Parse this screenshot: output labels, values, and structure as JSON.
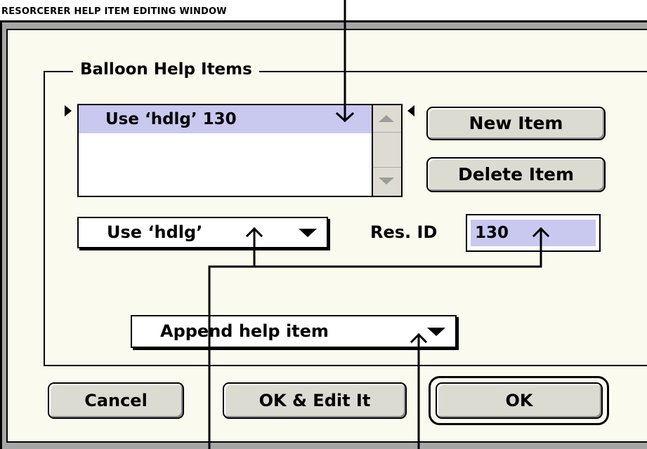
{
  "caption": "RESORCERER HELP ITEM EDITING WINDOW",
  "group_box": {
    "title": "Balloon Help Items"
  },
  "items_list": {
    "items": [
      "Use ‘hdlg’ 130"
    ],
    "selected_index": 0
  },
  "buttons": {
    "new_item": "New Item",
    "delete_item": "Delete Item",
    "cancel": "Cancel",
    "ok_edit": "OK & Edit It",
    "ok": "OK"
  },
  "type_popup": {
    "value": "Use ‘hdlg’"
  },
  "res_id": {
    "label": "Res. ID",
    "value": "130"
  },
  "action_popup": {
    "value": "Append help item"
  },
  "colors": {
    "window_background": "#fbfaef",
    "selection_highlight": "#c9c8ef",
    "button_face": "#dcdbd2",
    "frame_gray": "#a6a6a6"
  }
}
